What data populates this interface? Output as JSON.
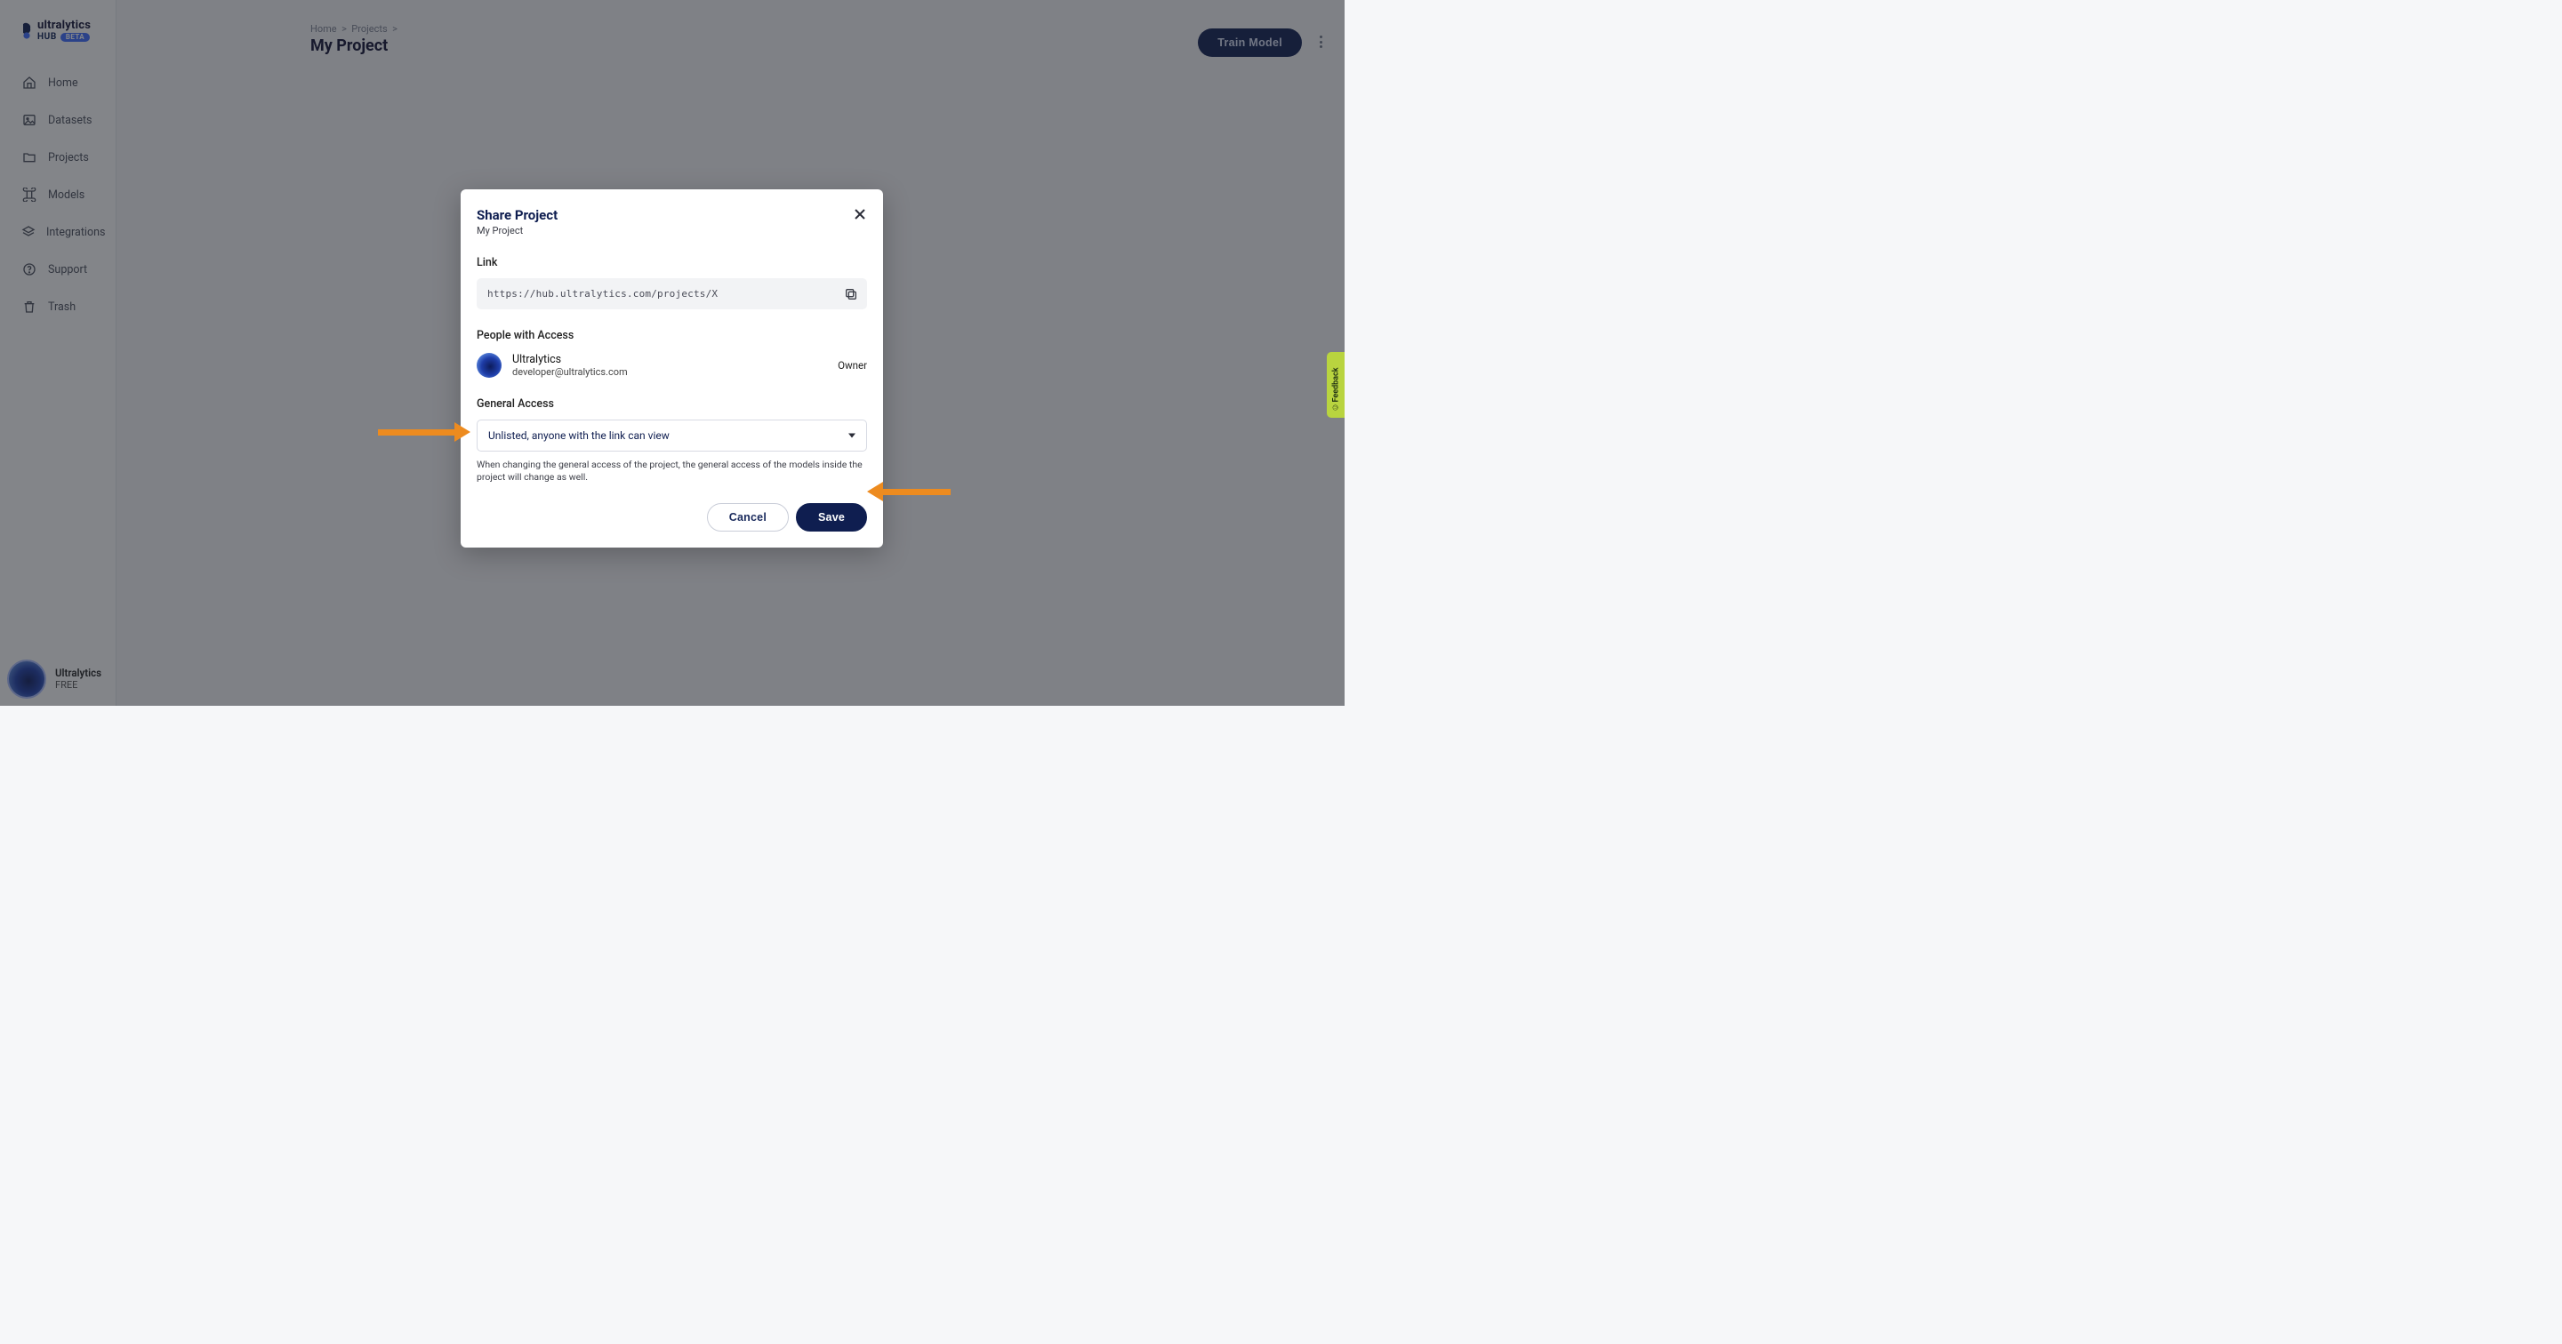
{
  "brand": {
    "word": "ultralytics",
    "hub": "HUB",
    "beta": "BETA"
  },
  "nav": [
    {
      "id": "home",
      "label": "Home"
    },
    {
      "id": "datasets",
      "label": "Datasets"
    },
    {
      "id": "projects",
      "label": "Projects"
    },
    {
      "id": "models",
      "label": "Models"
    },
    {
      "id": "integrations",
      "label": "Integrations"
    },
    {
      "id": "support",
      "label": "Support"
    },
    {
      "id": "trash",
      "label": "Trash"
    }
  ],
  "sidebar_footer": {
    "name": "Ultralytics",
    "plan": "FREE"
  },
  "breadcrumb": {
    "home": "Home",
    "projects": "Projects"
  },
  "page_title": "My Project",
  "train_button": "Train Model",
  "modal": {
    "title": "Share Project",
    "subtitle": "My Project",
    "link_label": "Link",
    "link_value": "https://hub.ultralytics.com/projects/X",
    "people_label": "People with Access",
    "person": {
      "name": "Ultralytics",
      "email": "developer@ultralytics.com",
      "role": "Owner"
    },
    "access_label": "General Access",
    "access_value": "Unlisted, anyone with the link can view",
    "access_help": "When changing the general access of the project, the general access of the models inside the project will change as well.",
    "cancel": "Cancel",
    "save": "Save"
  },
  "feedback": "Feedback"
}
